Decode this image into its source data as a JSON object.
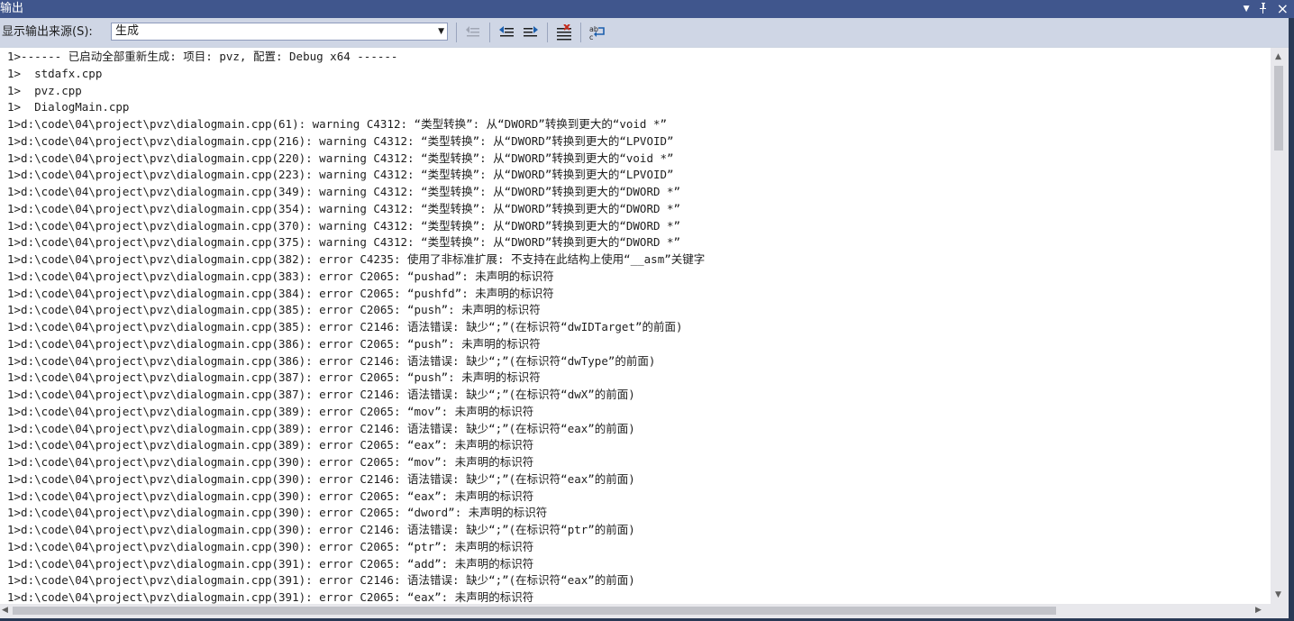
{
  "window": {
    "title": "输出"
  },
  "title_icons": {
    "dropdown": "▼",
    "pin": "pin-icon",
    "close": "×"
  },
  "toolbar": {
    "source_label": "显示输出来源(S):",
    "source_value": "生成",
    "buttons": [
      "go-to-previous-message-icon",
      "find-previous-icon",
      "find-next-icon",
      "clear-all-icon",
      "toggle-word-wrap-icon"
    ]
  },
  "colors": {
    "title_bg": "#40568d",
    "toolbar_bg": "#cfd6e5",
    "output_bg": "#ffffff",
    "text": "#1e1e1e"
  },
  "output": {
    "lines": [
      "1>------ 已启动全部重新生成: 项目: pvz, 配置: Debug x64 ------",
      "1>  stdafx.cpp",
      "1>  pvz.cpp",
      "1>  DialogMain.cpp",
      "1>d:\\code\\04\\project\\pvz\\dialogmain.cpp(61): warning C4312: “类型转换”: 从“DWORD”转换到更大的“void *”",
      "1>d:\\code\\04\\project\\pvz\\dialogmain.cpp(216): warning C4312: “类型转换”: 从“DWORD”转换到更大的“LPVOID”",
      "1>d:\\code\\04\\project\\pvz\\dialogmain.cpp(220): warning C4312: “类型转换”: 从“DWORD”转换到更大的“void *”",
      "1>d:\\code\\04\\project\\pvz\\dialogmain.cpp(223): warning C4312: “类型转换”: 从“DWORD”转换到更大的“LPVOID”",
      "1>d:\\code\\04\\project\\pvz\\dialogmain.cpp(349): warning C4312: “类型转换”: 从“DWORD”转换到更大的“DWORD *”",
      "1>d:\\code\\04\\project\\pvz\\dialogmain.cpp(354): warning C4312: “类型转换”: 从“DWORD”转换到更大的“DWORD *”",
      "1>d:\\code\\04\\project\\pvz\\dialogmain.cpp(370): warning C4312: “类型转换”: 从“DWORD”转换到更大的“DWORD *”",
      "1>d:\\code\\04\\project\\pvz\\dialogmain.cpp(375): warning C4312: “类型转换”: 从“DWORD”转换到更大的“DWORD *”",
      "1>d:\\code\\04\\project\\pvz\\dialogmain.cpp(382): error C4235: 使用了非标准扩展: 不支持在此结构上使用“__asm”关键字",
      "1>d:\\code\\04\\project\\pvz\\dialogmain.cpp(383): error C2065: “pushad”: 未声明的标识符",
      "1>d:\\code\\04\\project\\pvz\\dialogmain.cpp(384): error C2065: “pushfd”: 未声明的标识符",
      "1>d:\\code\\04\\project\\pvz\\dialogmain.cpp(385): error C2065: “push”: 未声明的标识符",
      "1>d:\\code\\04\\project\\pvz\\dialogmain.cpp(385): error C2146: 语法错误: 缺少“;”(在标识符“dwIDTarget”的前面)",
      "1>d:\\code\\04\\project\\pvz\\dialogmain.cpp(386): error C2065: “push”: 未声明的标识符",
      "1>d:\\code\\04\\project\\pvz\\dialogmain.cpp(386): error C2146: 语法错误: 缺少“;”(在标识符“dwType”的前面)",
      "1>d:\\code\\04\\project\\pvz\\dialogmain.cpp(387): error C2065: “push”: 未声明的标识符",
      "1>d:\\code\\04\\project\\pvz\\dialogmain.cpp(387): error C2146: 语法错误: 缺少“;”(在标识符“dwX”的前面)",
      "1>d:\\code\\04\\project\\pvz\\dialogmain.cpp(389): error C2065: “mov”: 未声明的标识符",
      "1>d:\\code\\04\\project\\pvz\\dialogmain.cpp(389): error C2146: 语法错误: 缺少“;”(在标识符“eax”的前面)",
      "1>d:\\code\\04\\project\\pvz\\dialogmain.cpp(389): error C2065: “eax”: 未声明的标识符",
      "1>d:\\code\\04\\project\\pvz\\dialogmain.cpp(390): error C2065: “mov”: 未声明的标识符",
      "1>d:\\code\\04\\project\\pvz\\dialogmain.cpp(390): error C2146: 语法错误: 缺少“;”(在标识符“eax”的前面)",
      "1>d:\\code\\04\\project\\pvz\\dialogmain.cpp(390): error C2065: “eax”: 未声明的标识符",
      "1>d:\\code\\04\\project\\pvz\\dialogmain.cpp(390): error C2065: “dword”: 未声明的标识符",
      "1>d:\\code\\04\\project\\pvz\\dialogmain.cpp(390): error C2146: 语法错误: 缺少“;”(在标识符“ptr”的前面)",
      "1>d:\\code\\04\\project\\pvz\\dialogmain.cpp(390): error C2065: “ptr”: 未声明的标识符",
      "1>d:\\code\\04\\project\\pvz\\dialogmain.cpp(391): error C2065: “add”: 未声明的标识符",
      "1>d:\\code\\04\\project\\pvz\\dialogmain.cpp(391): error C2146: 语法错误: 缺少“;”(在标识符“eax”的前面)",
      "1>d:\\code\\04\\project\\pvz\\dialogmain.cpp(391): error C2065: “eax”: 未声明的标识符"
    ]
  }
}
